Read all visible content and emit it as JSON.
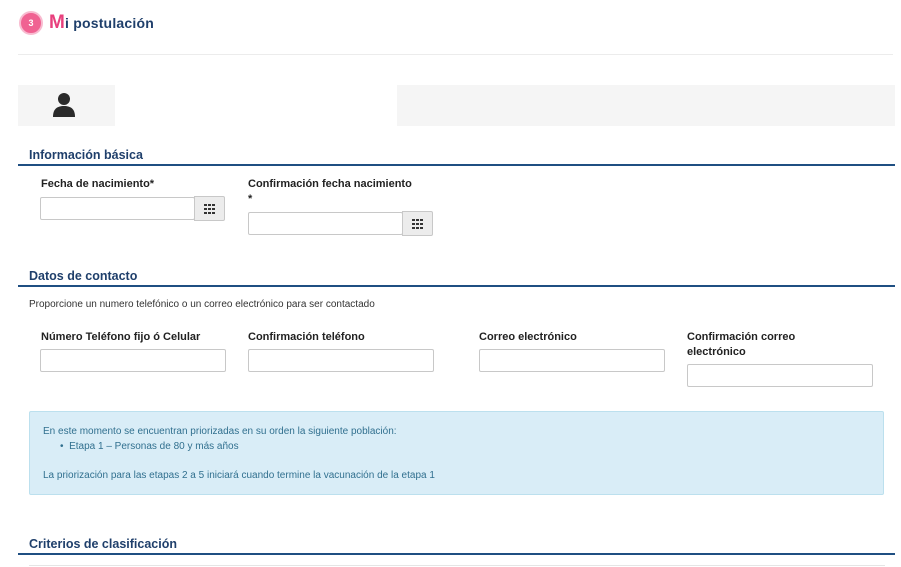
{
  "header": {
    "step_number": "3",
    "title_cap": "M",
    "title_rest": "i postulación"
  },
  "sections": {
    "basic": {
      "title": "Información básica",
      "birth_label": "Fecha de nacimiento*",
      "birth_confirm_label_line1": "Confirmación fecha nacimiento",
      "birth_confirm_label_line2": "*"
    },
    "contact": {
      "title": "Datos de contacto",
      "helper": "Proporcione un numero telefónico o un correo electrónico para ser contactado",
      "phone_label": "Número Teléfono fijo ó Celular",
      "phone_confirm_label": "Confirmación teléfono",
      "email_label": "Correo electrónico",
      "email_confirm_label_line1": "Confirmación correo",
      "email_confirm_label_line2": "electrónico"
    },
    "criteria": {
      "title": "Criterios de clasificación"
    }
  },
  "info": {
    "line1": "En este momento se encuentran priorizadas en su orden la siguiente población:",
    "bullet": "Etapa 1 – Personas de 80 y más años",
    "line3": "La priorización para las etapas 2 a 5 iniciará cuando termine la vacunación de la etapa 1"
  },
  "colors": {
    "accent_pink": "#e8407d",
    "section_blue": "#1f4f82",
    "info_bg": "#d9edf7"
  }
}
